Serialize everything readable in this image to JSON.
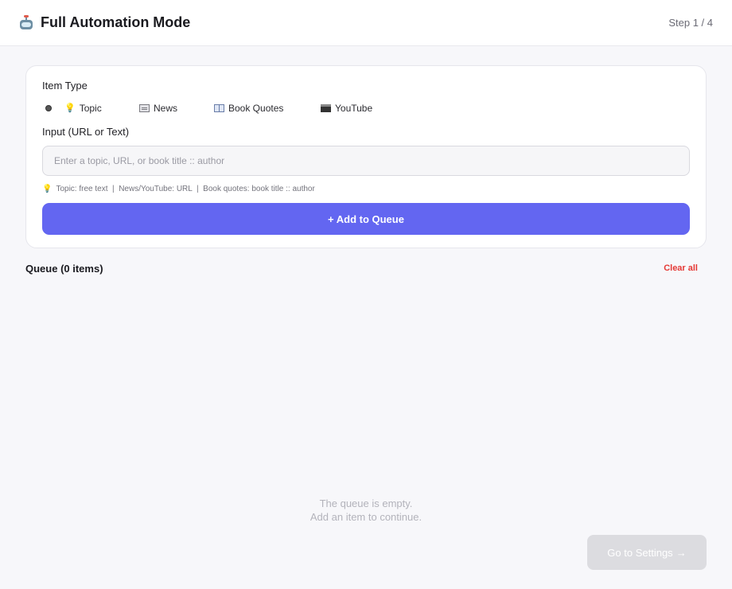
{
  "header": {
    "title": "Full Automation Mode",
    "step": "Step 1 / 4",
    "icon": "robot-icon"
  },
  "form": {
    "item_type_label": "Item Type",
    "options": [
      {
        "label": "Topic",
        "icon": "lightbulb-icon"
      },
      {
        "label": "News",
        "icon": "newspaper-icon"
      },
      {
        "label": "Book Quotes",
        "icon": "book-icon"
      },
      {
        "label": "YouTube",
        "icon": "clapperboard-icon"
      }
    ],
    "input_label": "Input (URL or Text)",
    "input_placeholder": "Enter a topic, URL, or book title :: author",
    "input_value": "",
    "hint": "Topic: free text  |  News/YouTube: URL  |  Book quotes: book title :: author",
    "add_button": "+ Add to Queue"
  },
  "queue": {
    "title": "Queue (0 items)",
    "clear_all": "Clear all",
    "empty_line1": "The queue is empty.",
    "empty_line2": "Add an item to continue."
  },
  "footer": {
    "go_button": "Go to Settings",
    "arrow": "→"
  },
  "colors": {
    "accent": "#6366f1",
    "danger": "#e53935",
    "disabled": "#dcdce0"
  }
}
